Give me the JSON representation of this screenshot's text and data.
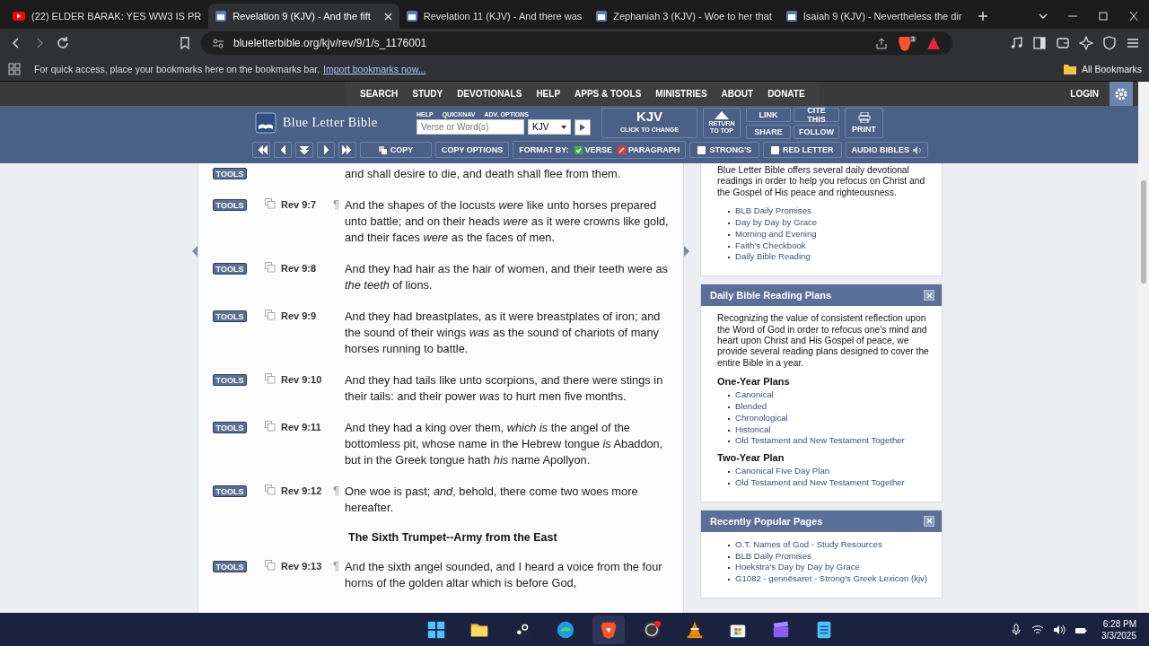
{
  "browser": {
    "tabs": [
      {
        "title": "(22) ELDER BARAK: YES WW3 IS PR",
        "kind": "video",
        "selected": false
      },
      {
        "title": "Revelation 9 (KJV) - And the fift",
        "kind": "book",
        "selected": true
      },
      {
        "title": "Revelation 11 (KJV) - And there was",
        "kind": "book",
        "selected": false
      },
      {
        "title": "Zephaniah 3 (KJV) - Woe to her that",
        "kind": "book",
        "selected": false
      },
      {
        "title": "Isaiah 9 (KJV) - Nevertheless the dir",
        "kind": "book",
        "selected": false
      }
    ],
    "address": "blueletterbible.org/kjv/rev/9/1/s_1176001",
    "shield_count": "3",
    "bookmarks_message": "For quick access, place your bookmarks here on the bookmarks bar.",
    "bookmarks_link": "Import bookmarks now...",
    "all_bookmarks": "All Bookmarks"
  },
  "site": {
    "nav": [
      "SEARCH",
      "STUDY",
      "DEVOTIONALS",
      "HELP",
      "APPS & TOOLS",
      "MINISTRIES",
      "ABOUT",
      "DONATE"
    ],
    "login": "LOGIN",
    "logo": "Blue Letter Bible",
    "search_links": [
      "HELP",
      "QUICKNAV",
      "ADV. OPTIONS"
    ],
    "search_placeholder": "Verse or Word(s)",
    "search_version": "KJV",
    "version_title": "KJV",
    "version_subtitle": "CLICK TO CHANGE",
    "return_top": "RETURN TO TOP",
    "action_buttons": [
      "LINK",
      "SHARE",
      "CITE THIS",
      "FOLLOW"
    ],
    "print": "PRINT",
    "copy": "COPY",
    "copy_options": "COPY OPTIONS",
    "format_label": "FORMAT BY:",
    "formats": [
      {
        "label": "VERSE",
        "selected": true
      },
      {
        "label": "PARAGRAPH",
        "selected": false
      }
    ],
    "toggles": [
      {
        "label": "STRONG'S",
        "checked": false
      },
      {
        "label": "RED LETTER",
        "checked": false
      }
    ],
    "audio": "AUDIO BIBLES"
  },
  "verses": [
    {
      "kind": "verse",
      "tools": "TOOLS",
      "text": "and shall desire to die, and death shall flee from them."
    },
    {
      "kind": "verse",
      "tools": "TOOLS",
      "ref": "Rev 9:7",
      "mark": "¶",
      "text": "And the shapes of the locusts *were* like unto horses prepared unto battle; and on their heads *were* as it were crowns like gold, and their faces *were* as the faces of men."
    },
    {
      "kind": "verse",
      "tools": "TOOLS",
      "ref": "Rev 9:8",
      "text": "And they had hair as the hair of women, and their teeth were as *the teeth* of lions."
    },
    {
      "kind": "verse",
      "tools": "TOOLS",
      "ref": "Rev 9:9",
      "text": "And they had breastplates, as it were breastplates of iron; and the sound of their wings *was* as the sound of chariots of many horses running to battle."
    },
    {
      "kind": "verse",
      "tools": "TOOLS",
      "ref": "Rev 9:10",
      "text": "And they had tails like unto scorpions, and there were stings in their tails: and their power *was* to hurt men five months."
    },
    {
      "kind": "verse",
      "tools": "TOOLS",
      "ref": "Rev 9:11",
      "text": "And they had a king over them, *which is* the angel of the bottomless pit, whose name in the Hebrew tongue *is* Abaddon, but in the Greek tongue hath *his* name Apollyon."
    },
    {
      "kind": "verse",
      "tools": "TOOLS",
      "ref": "Rev 9:12",
      "mark": "¶",
      "text": "One woe is past; *and*, behold, there come two woes more hereafter."
    },
    {
      "kind": "heading",
      "text": "The Sixth Trumpet--Army from the East"
    },
    {
      "kind": "verse",
      "tools": "TOOLS",
      "ref": "Rev 9:13",
      "mark": "¶",
      "text": "And the sixth angel sounded, and I heard a voice from the four horns of the golden altar which is before God,"
    }
  ],
  "sidebar": [
    {
      "body": "Blue Letter Bible offers several daily devotional readings in order to help you refocus on Christ and the Gospel of His peace and righteousness.",
      "groups": [
        {
          "links": [
            "BLB Daily Promises",
            "Day by Day by Grace",
            "Morning and Evening",
            "Faith's Checkbook",
            "Daily Bible Reading"
          ]
        }
      ]
    },
    {
      "title": "Daily Bible Reading Plans",
      "body": "Recognizing the value of consistent reflection upon the Word of God in order to refocus one's mind and heart upon Christ and His Gospel of peace, we provide several reading plans designed to cover the entire Bible in a year.",
      "groups": [
        {
          "heading": "One-Year Plans",
          "links": [
            "Canonical",
            "Blended",
            "Chronological",
            "Historical",
            "Old Testament and New Testament Together"
          ]
        },
        {
          "heading": "Two-Year Plan",
          "links": [
            "Canonical Five Day Plan",
            "Old Testament and New Testament Together"
          ]
        }
      ]
    },
    {
      "title": "Recently Popular Pages",
      "groups": [
        {
          "links": [
            "O.T. Names of God - Study Resources",
            "BLB Daily Promises",
            "Hoekstra's Day by Day by Grace",
            "G1082 - gennēsaret - Strong's Greek Lexicon (kjv)"
          ]
        }
      ]
    }
  ],
  "taskbar": {
    "apps": [
      {
        "kind": "start",
        "selected": false
      },
      {
        "kind": "folder",
        "selected": false
      },
      {
        "kind": "steam",
        "selected": false
      },
      {
        "kind": "edge",
        "selected": false
      },
      {
        "kind": "lion",
        "selected": true
      },
      {
        "kind": "obs",
        "selected": false
      },
      {
        "kind": "cone",
        "selected": false
      },
      {
        "kind": "store",
        "selected": false
      },
      {
        "kind": "clapper",
        "selected": false
      },
      {
        "kind": "notepad",
        "selected": false
      }
    ],
    "time": "6:28 PM",
    "date": "3/3/2025"
  }
}
